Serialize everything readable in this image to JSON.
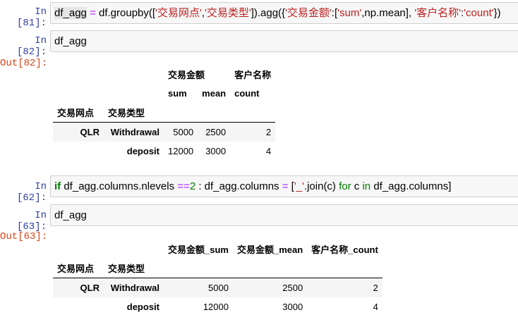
{
  "cells": [
    {
      "prompt": "In [81]:",
      "code": [
        {
          "t": "df_agg",
          "c": "hl"
        },
        {
          "t": " ",
          "c": ""
        },
        {
          "t": "=",
          "c": "op"
        },
        {
          "t": " df.groupby([",
          "c": ""
        },
        {
          "t": "'交易网点'",
          "c": "str"
        },
        {
          "t": ",",
          "c": ""
        },
        {
          "t": "'交易类型'",
          "c": "str"
        },
        {
          "t": "]).agg({",
          "c": ""
        },
        {
          "t": "'交易金额'",
          "c": "str"
        },
        {
          "t": ":[",
          "c": ""
        },
        {
          "t": "'sum'",
          "c": "str"
        },
        {
          "t": ",np.mean], ",
          "c": ""
        },
        {
          "t": "'客户名称'",
          "c": "str"
        },
        {
          "t": ":",
          "c": ""
        },
        {
          "t": "'count'",
          "c": "str"
        },
        {
          "t": "})",
          "c": ""
        }
      ]
    },
    {
      "prompt": "In [82]:",
      "code": [
        {
          "t": "df_agg",
          "c": ""
        }
      ]
    },
    {
      "prompt": "In [62]:",
      "code": [
        {
          "t": "if",
          "c": "kw"
        },
        {
          "t": " df_agg.columns.nlevels ",
          "c": ""
        },
        {
          "t": "==",
          "c": "op"
        },
        {
          "t": "2",
          "c": "num"
        },
        {
          "t": " : df_agg.columns ",
          "c": ""
        },
        {
          "t": "=",
          "c": "op"
        },
        {
          "t": " [",
          "c": ""
        },
        {
          "t": "'_'",
          "c": "str"
        },
        {
          "t": ".join(c) ",
          "c": ""
        },
        {
          "t": "for",
          "c": "cw"
        },
        {
          "t": " c ",
          "c": ""
        },
        {
          "t": "in",
          "c": "cw"
        },
        {
          "t": " df_agg.columns]",
          "c": ""
        }
      ]
    },
    {
      "prompt": "In [63]:",
      "code": [
        {
          "t": "df_agg",
          "c": ""
        }
      ]
    }
  ],
  "outputs": [
    {
      "prompt": "Out[82]:",
      "header_level0": [
        "交易金额",
        "客户名称"
      ],
      "header_level1": [
        "sum",
        "mean",
        "count"
      ],
      "index_names": [
        "交易网点",
        "交易类型"
      ],
      "rows": [
        {
          "idx0": "QLR",
          "idx1": "Withdrawal",
          "values": [
            "5000",
            "2500",
            "2"
          ]
        },
        {
          "idx0": "",
          "idx1": "deposit",
          "values": [
            "12000",
            "3000",
            "4"
          ]
        }
      ]
    },
    {
      "prompt": "Out[63]:",
      "columns": [
        "交易金额_sum",
        "交易金额_mean",
        "客户名称_count"
      ],
      "index_names": [
        "交易网点",
        "交易类型"
      ],
      "rows": [
        {
          "idx0": "QLR",
          "idx1": "Withdrawal",
          "values": [
            "5000",
            "2500",
            "2"
          ]
        },
        {
          "idx0": "",
          "idx1": "deposit",
          "values": [
            "12000",
            "3000",
            "4"
          ]
        }
      ]
    }
  ]
}
